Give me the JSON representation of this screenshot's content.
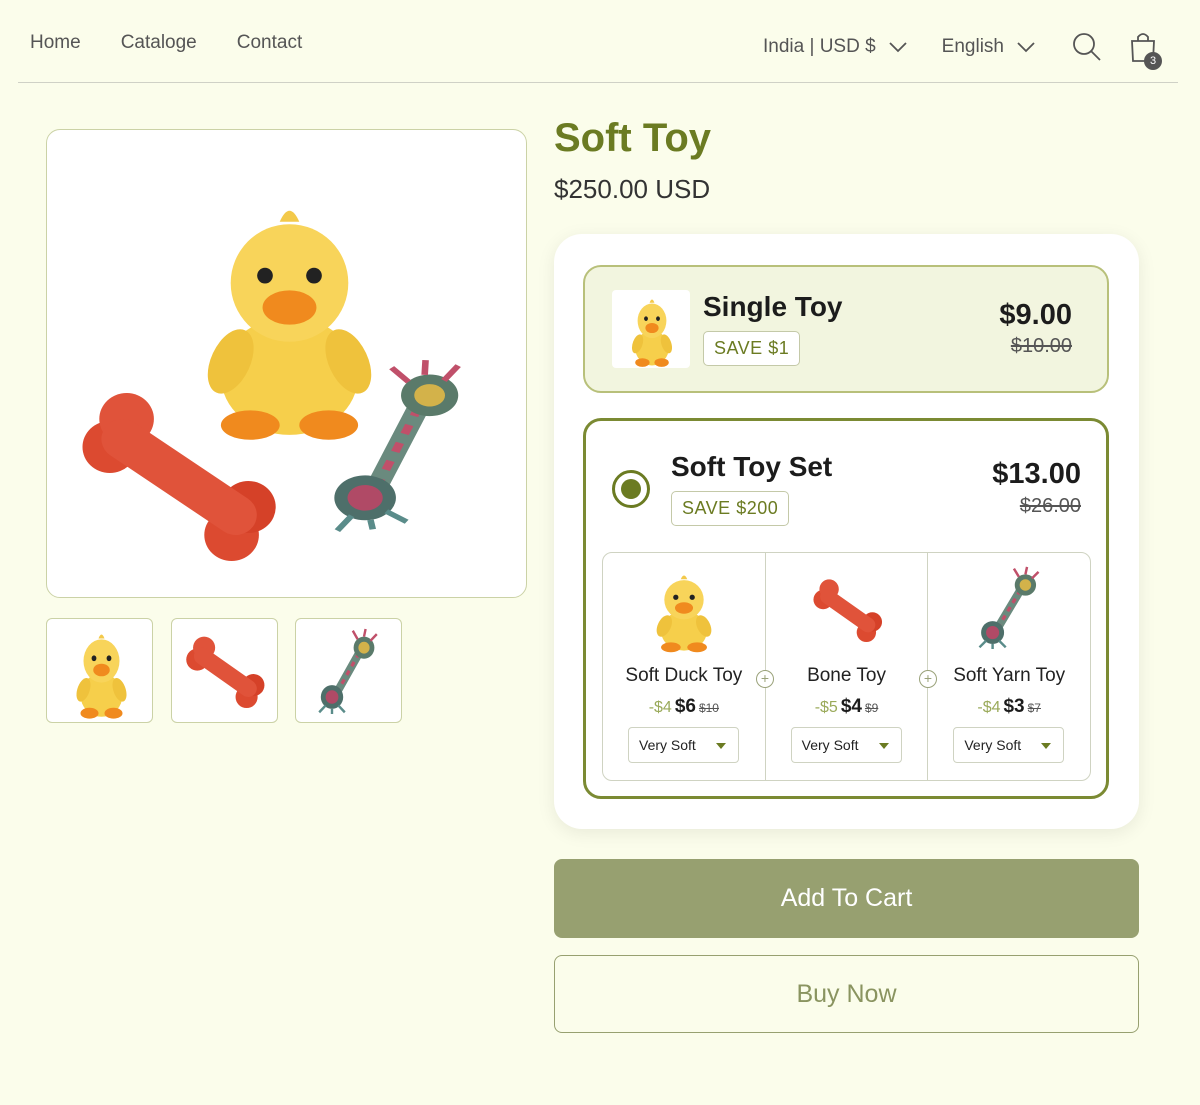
{
  "header": {
    "nav": [
      "Home",
      "Cataloge",
      "Contact"
    ],
    "region": "India | USD $",
    "language": "English",
    "cart_count": "3"
  },
  "product": {
    "title": "Soft Toy",
    "price": "$250.00 USD"
  },
  "bundle": {
    "single": {
      "name": "Single Toy",
      "save": "SAVE $1",
      "price": "$9.00",
      "old_price": "$10.00"
    },
    "set": {
      "name": "Soft Toy Set",
      "save": "SAVE $200",
      "price": "$13.00",
      "old_price": "$26.00",
      "selected": true,
      "items": [
        {
          "name": "Soft Duck Toy",
          "discount": "-$4",
          "price": "$6",
          "was": "$10",
          "variant": "Very Soft",
          "icon": "duck-icon"
        },
        {
          "name": "Bone Toy",
          "discount": "-$5",
          "price": "$4",
          "was": "$9",
          "variant": "Very Soft",
          "icon": "bone-icon"
        },
        {
          "name": "Soft Yarn Toy",
          "discount": "-$4",
          "price": "$3",
          "was": "$7",
          "variant": "Very Soft",
          "icon": "rope-icon"
        }
      ]
    }
  },
  "buttons": {
    "add_to_cart": "Add To Cart",
    "buy_now": "Buy Now"
  },
  "colors": {
    "background": "#fbfdeb",
    "brand": "#6b7b22",
    "button": "#97a070"
  }
}
